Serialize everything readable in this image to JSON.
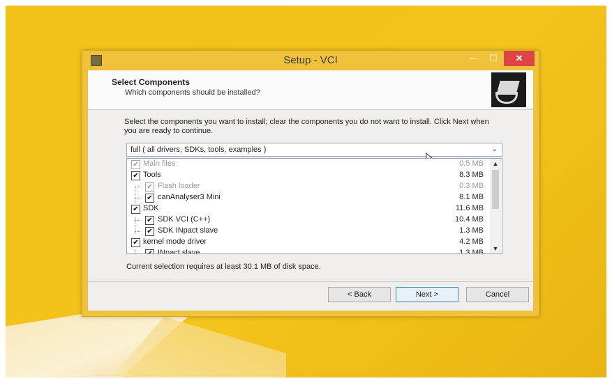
{
  "window": {
    "title": "Setup - VCI",
    "min_glyph": "—",
    "max_glyph": "☐",
    "close_glyph": "✕",
    "app_icon": "installer-icon"
  },
  "header": {
    "title": "Select Components",
    "subtitle": "Which components should be installed?",
    "image": "disk-install-icon"
  },
  "instructions": "Select the components you want to install; clear the components you do not want to install. Click Next when you are ready to continue.",
  "install_type": {
    "selected": "full ( all drivers, SDKs, tools, examples )",
    "chevron": "⌄"
  },
  "components": [
    {
      "label": "Main files",
      "size": "0.5 MB",
      "checked": true,
      "disabled": true,
      "level": 0
    },
    {
      "label": "Tools",
      "size": "8.3 MB",
      "checked": true,
      "disabled": false,
      "level": 0
    },
    {
      "label": "Flash loader",
      "size": "0.3 MB",
      "checked": true,
      "disabled": true,
      "level": 1
    },
    {
      "label": "canAnalyser3 Mini",
      "size": "8.1 MB",
      "checked": true,
      "disabled": false,
      "level": 1
    },
    {
      "label": "SDK",
      "size": "11.6 MB",
      "checked": true,
      "disabled": false,
      "level": 0
    },
    {
      "label": "SDK VCI (C++)",
      "size": "10.4 MB",
      "checked": true,
      "disabled": false,
      "level": 1
    },
    {
      "label": "SDK INpact slave",
      "size": "1.3 MB",
      "checked": true,
      "disabled": false,
      "level": 1
    },
    {
      "label": "kernel mode driver",
      "size": "4.2 MB",
      "checked": true,
      "disabled": false,
      "level": 0
    },
    {
      "label": "INpact slave",
      "size": "1.3 MB",
      "checked": true,
      "disabled": false,
      "level": 1
    }
  ],
  "check_glyph": "✔",
  "scroll": {
    "up": "▲",
    "down": "▼"
  },
  "disk_space": "Current selection requires at least 30.1 MB of disk space.",
  "buttons": {
    "back": "< Back",
    "next": "Next >",
    "cancel": "Cancel"
  },
  "colors": {
    "desktop": "#f2c11a",
    "window_frame": "#f0c23a",
    "close_button": "#e04343",
    "default_button_border": "#3c7fb1"
  }
}
